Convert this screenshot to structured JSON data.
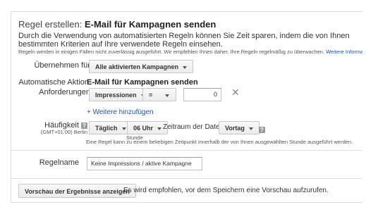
{
  "header": {
    "prefix": "Regel erstellen:",
    "title": "E-Mail für Kampagnen senden"
  },
  "description": "Durch die Verwendung von automatisierten Regeln können Sie Zeit sparen, indem die von Ihnen bestimmten Kriterien auf Ihre verwendete Regeln einsehen.",
  "note": {
    "text": "Regeln werden in einigen Fällen nicht zuverlässig ausgeführt. Wir empfehlen Ihnen daher, Ihre Regeln regelmäßig zu überwachen.",
    "link": "Weitere Informationen"
  },
  "apply_to": {
    "label": "Übernehmen für",
    "value": "Alle aktivierten Kampagnen"
  },
  "action": {
    "label": "Automatische Aktion",
    "value": "E-Mail für Kampagnen senden"
  },
  "requirements": {
    "label": "Anforderungen",
    "metric": "Impressionen",
    "operator": "=",
    "value": "0",
    "remove": "✕",
    "add_more": "+ Weitere hinzufügen"
  },
  "frequency": {
    "label": "Häufigkeit",
    "timezone": "(GMT+01:00) Berlin",
    "period": "Täglich",
    "time": "06 Uhr",
    "time_caption": "Stunde",
    "data_range_label": "Zeitraum der Daten:",
    "data_range": "Vortag",
    "hint": "Eine Regel kann zu einem beliebigen Zeitpunkt innerhalb der von Ihnen ausgewählten Stunde ausgeführt werden."
  },
  "rule_name": {
    "label": "Regelname",
    "value": "Keine Impressions / aktive Kampagne"
  },
  "preview": {
    "button": "Vorschau der Ergebnisse anzeigen",
    "text": "Es wird empfohlen, vor dem Speichern eine Vorschau aufzurufen."
  },
  "help_glyph": "?"
}
